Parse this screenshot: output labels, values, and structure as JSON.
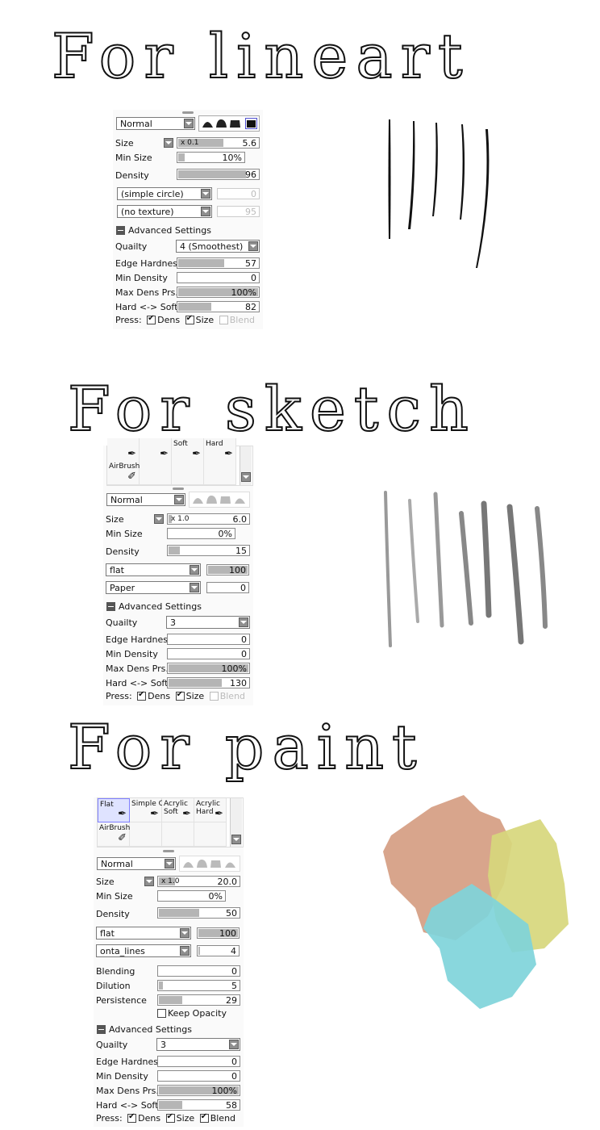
{
  "headings": {
    "lineart": "For lineart",
    "sketch": "For sketch",
    "paint": "For paint"
  },
  "lineart": {
    "blend_mode": "Normal",
    "size": {
      "label": "Size",
      "multiplier": "x 0.1",
      "value": "5.6",
      "fill": 0.55
    },
    "min_size": {
      "label": "Min Size",
      "value": "10%",
      "fill": 0.1
    },
    "density": {
      "label": "Density",
      "value": "96",
      "fill": 0.96
    },
    "shape_select": "(simple circle)",
    "shape_value": "0",
    "texture_select": "(no texture)",
    "texture_value": "95",
    "advanced": "Advanced Settings",
    "quality": {
      "label": "Quailty",
      "value": "4 (Smoothest)"
    },
    "edge_hardness": {
      "label": "Edge Hardness",
      "value": "57",
      "fill": 0.57
    },
    "min_density": {
      "label": "Min Density",
      "value": "0",
      "fill": 0
    },
    "max_dens": {
      "label": "Max Dens Prs.",
      "value": "100%",
      "fill": 1.0
    },
    "hard_soft": {
      "label": "Hard <-> Soft",
      "value": "82",
      "fill": 0.41
    },
    "press": {
      "label": "Press:",
      "dens": "Dens",
      "size": "Size",
      "blend": "Blend"
    }
  },
  "sketch": {
    "brushes": [
      {
        "name": ""
      },
      {
        "name": ""
      },
      {
        "name": "Soft"
      },
      {
        "name": "Hard"
      },
      {
        "name": "AirBrush"
      }
    ],
    "blend_mode": "Normal",
    "size": {
      "label": "Size",
      "multiplier": "x 1.0",
      "value": "6.0",
      "fill": 0.06
    },
    "min_size": {
      "label": "Min Size",
      "value": "0%",
      "fill": 0
    },
    "density": {
      "label": "Density",
      "value": "15",
      "fill": 0.15
    },
    "shape_select": "flat",
    "shape_value": "100",
    "texture_select": "Paper",
    "texture_value": "0",
    "advanced": "Advanced Settings",
    "quality": {
      "label": "Quailty",
      "value": "3"
    },
    "edge_hardness": {
      "label": "Edge Hardness",
      "value": "0",
      "fill": 0
    },
    "min_density": {
      "label": "Min Density",
      "value": "0",
      "fill": 0
    },
    "max_dens": {
      "label": "Max Dens Prs.",
      "value": "100%",
      "fill": 1.0
    },
    "hard_soft": {
      "label": "Hard <-> Soft",
      "value": "130",
      "fill": 0.65
    },
    "press": {
      "label": "Press:",
      "dens": "Dens",
      "size": "Size",
      "blend": "Blend"
    }
  },
  "paint": {
    "brushes": [
      {
        "name": "Flat"
      },
      {
        "name": "Simple C"
      },
      {
        "name": "Acrylic\nSoft"
      },
      {
        "name": "Acrylic\nHard"
      },
      {
        "name": "AirBrush"
      }
    ],
    "blend_mode": "Normal",
    "size": {
      "label": "Size",
      "multiplier": "x 1.0",
      "value": "20.0",
      "fill": 0.2
    },
    "min_size": {
      "label": "Min Size",
      "value": "0%",
      "fill": 0
    },
    "density": {
      "label": "Density",
      "value": "50",
      "fill": 0.5
    },
    "shape_select": "flat",
    "shape_value": "100",
    "texture_select": "onta_lines",
    "texture_value": "4",
    "blending": {
      "label": "Blending",
      "value": "0",
      "fill": 0
    },
    "dilution": {
      "label": "Dilution",
      "value": "5",
      "fill": 0.05
    },
    "persistence": {
      "label": "Persistence",
      "value": "29",
      "fill": 0.29
    },
    "keep_opacity": "Keep Opacity",
    "advanced": "Advanced Settings",
    "quality": {
      "label": "Quailty",
      "value": "3"
    },
    "edge_hardness": {
      "label": "Edge Hardness",
      "value": "0",
      "fill": 0
    },
    "min_density": {
      "label": "Min Density",
      "value": "0",
      "fill": 0
    },
    "max_dens": {
      "label": "Max Dens Prs.",
      "value": "100%",
      "fill": 1.0
    },
    "hard_soft": {
      "label": "Hard <-> Soft",
      "value": "58",
      "fill": 0.29
    },
    "press": {
      "label": "Press:",
      "dens": "Dens",
      "size": "Size",
      "blend": "Blend"
    }
  },
  "swatch_colors": {
    "salmon": "#d49b80",
    "yellow": "#d7d77c",
    "cyan": "#7fd4da"
  }
}
